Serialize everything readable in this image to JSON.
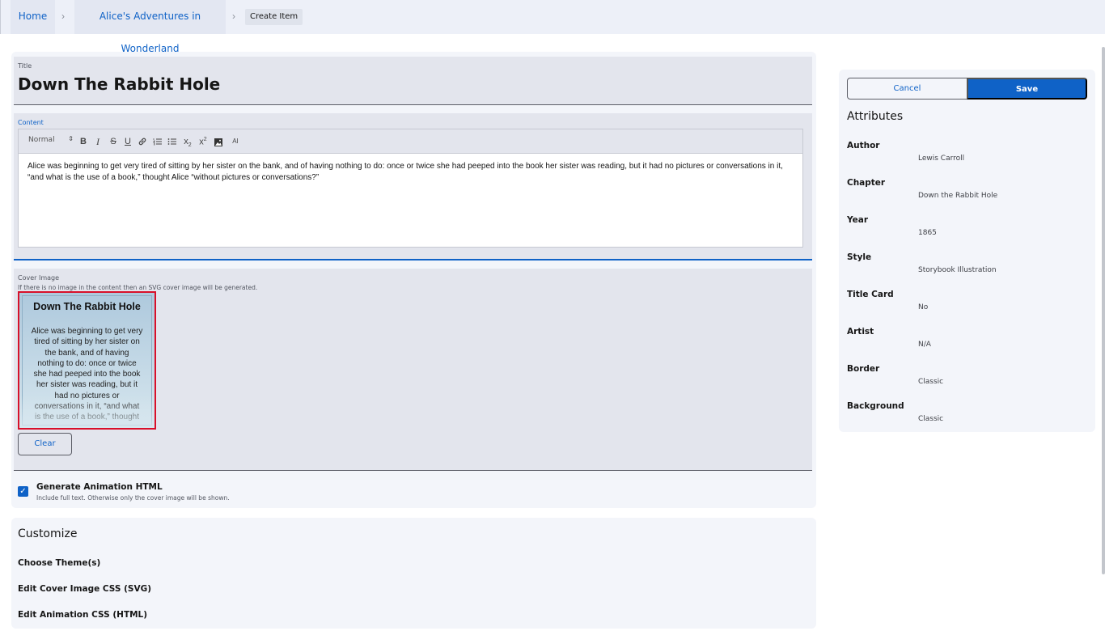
{
  "breadcrumb": {
    "home": "Home",
    "book": "Alice's Adventures in Wonderland",
    "current": "Create Item",
    "separator": "›"
  },
  "form": {
    "title_label": "Title",
    "title_value": "Down The Rabbit Hole",
    "content_label": "Content",
    "toolbar": {
      "format_select": "Normal",
      "buttons": [
        "bold-icon",
        "italic-icon",
        "strikethrough-icon",
        "underline-icon",
        "link-icon",
        "ordered-list-icon",
        "bullet-list-icon",
        "subscript-icon",
        "superscript-icon",
        "image-icon",
        "ai-icon"
      ],
      "ai_label": "AI"
    },
    "content_text": "Alice was beginning to get very tired of sitting by her sister on the bank, and of having nothing to do: once or twice she had peeped into the book her sister was reading, but it had no pictures or conversations in it, “and what is the use of a book,” thought Alice “without pictures or conversations?”",
    "cover_label": "Cover Image",
    "cover_hint": "If there is no image in the content then an SVG cover image will be generated.",
    "cover_preview": {
      "title": "Down The Rabbit Hole",
      "text": "Alice was beginning to get very tired of sitting by her sister on the bank, and of having nothing to do: once or twice she had peeped into the book her sister was reading, but it had no pictures or conversations in it, “and what is the use of a book,” thought"
    },
    "clear_label": "Clear",
    "generate_animation": {
      "label": "Generate Animation HTML",
      "hint": "Include full text. Otherwise only the cover image will be shown.",
      "checked": true
    }
  },
  "customize": {
    "title": "Customize",
    "items": [
      "Choose Theme(s)",
      "Edit Cover Image CSS (SVG)",
      "Edit Animation CSS (HTML)"
    ]
  },
  "sidebar": {
    "cancel_label": "Cancel",
    "save_label": "Save",
    "attributes_title": "Attributes",
    "attributes": [
      {
        "name": "Author",
        "value": "Lewis Carroll"
      },
      {
        "name": "Chapter",
        "value": "Down the Rabbit Hole"
      },
      {
        "name": "Year",
        "value": "1865"
      },
      {
        "name": "Style",
        "value": "Storybook Illustration"
      },
      {
        "name": "Title Card",
        "value": "No"
      },
      {
        "name": "Artist",
        "value": "N/A"
      },
      {
        "name": "Border",
        "value": "Classic"
      },
      {
        "name": "Background",
        "value": "Classic"
      }
    ]
  },
  "colors": {
    "accent": "#0f62c7",
    "cover_border": "#d8102a",
    "field_background": "#e3e5ed",
    "card_background": "#f3f5fa"
  }
}
